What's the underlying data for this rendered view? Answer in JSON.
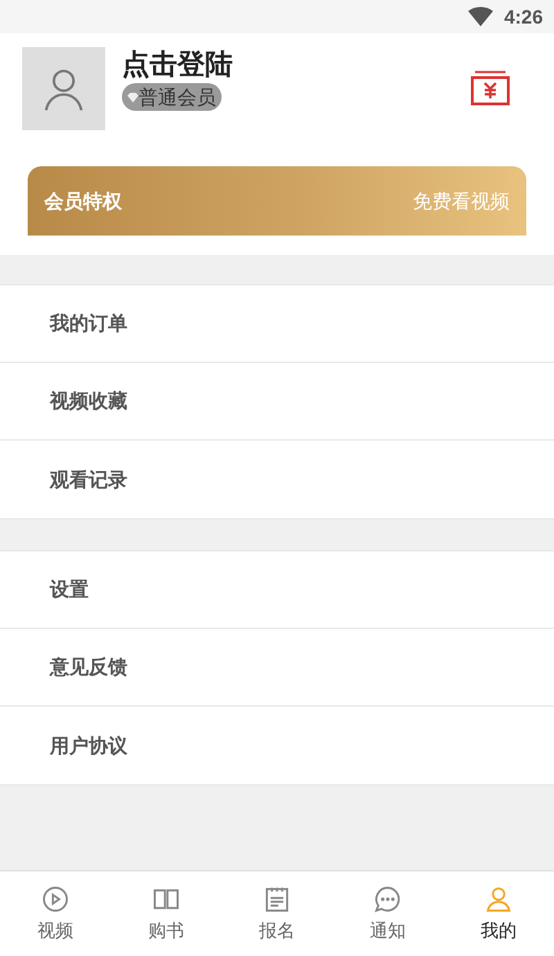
{
  "status_bar": {
    "time": "4:26"
  },
  "profile": {
    "name": "点击登陆",
    "badge": "普通会员"
  },
  "vip_banner": {
    "title": "会员特权",
    "subtitle": "免费看视频"
  },
  "menu_groups": [
    {
      "items": [
        {
          "label": "我的订单"
        },
        {
          "label": "视频收藏"
        },
        {
          "label": "观看记录"
        }
      ]
    },
    {
      "items": [
        {
          "label": "设置"
        },
        {
          "label": "意见反馈"
        },
        {
          "label": "用户协议"
        }
      ]
    }
  ],
  "tabs": [
    {
      "label": "视频",
      "kind": "video",
      "selected": false
    },
    {
      "label": "购书",
      "kind": "book",
      "selected": false
    },
    {
      "label": "报名",
      "kind": "signup",
      "selected": false
    },
    {
      "label": "通知",
      "kind": "message",
      "selected": false
    },
    {
      "label": "我的",
      "kind": "user",
      "selected": true
    }
  ]
}
